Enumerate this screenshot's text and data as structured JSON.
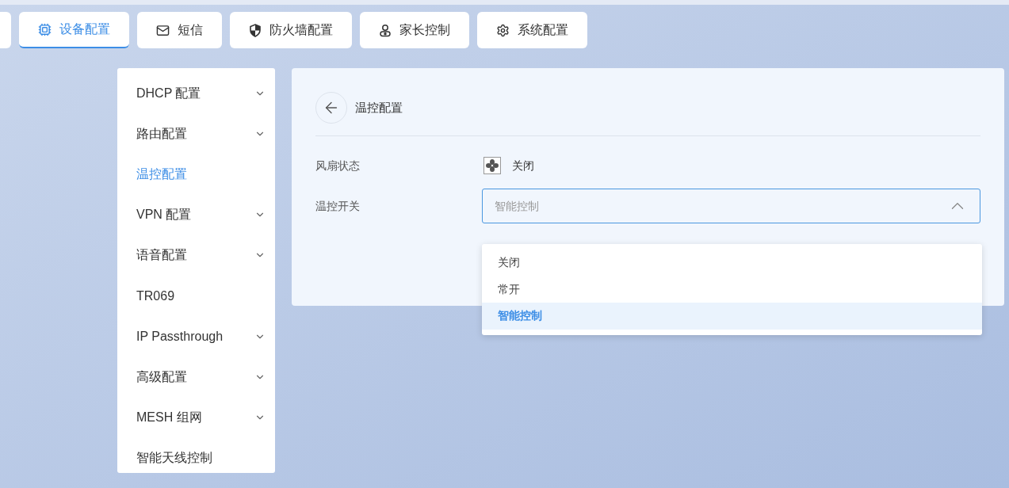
{
  "tabs": [
    {
      "label": "设备配置",
      "kind": "chip",
      "selected": true
    },
    {
      "label": "短信",
      "kind": "mail",
      "selected": false
    },
    {
      "label": "防火墙配置",
      "kind": "shield",
      "selected": false
    },
    {
      "label": "家长控制",
      "kind": "person",
      "selected": false
    },
    {
      "label": "系统配置",
      "kind": "gear",
      "selected": false
    }
  ],
  "sidebar": {
    "items": [
      {
        "label": "DHCP 配置",
        "expandable": true,
        "selected": false
      },
      {
        "label": "路由配置",
        "expandable": true,
        "selected": false
      },
      {
        "label": "温控配置",
        "expandable": false,
        "selected": true
      },
      {
        "label": "VPN 配置",
        "expandable": true,
        "selected": false
      },
      {
        "label": "语音配置",
        "expandable": true,
        "selected": false
      },
      {
        "label": "TR069",
        "expandable": false,
        "selected": false
      },
      {
        "label": "IP Passthrough",
        "expandable": true,
        "selected": false
      },
      {
        "label": "高级配置",
        "expandable": true,
        "selected": false
      },
      {
        "label": "MESH 组网",
        "expandable": true,
        "selected": false
      },
      {
        "label": "智能天线控制",
        "expandable": false,
        "selected": false
      }
    ]
  },
  "panel": {
    "title": "温控配置",
    "fan_status": {
      "label": "风扇状态",
      "value": "关闭"
    },
    "temp_switch": {
      "label": "温控开关",
      "value": "智能控制",
      "expanded": true,
      "options": [
        {
          "label": "关闭",
          "selected": false
        },
        {
          "label": "常开",
          "selected": false
        },
        {
          "label": "智能控制",
          "selected": true
        }
      ]
    }
  }
}
